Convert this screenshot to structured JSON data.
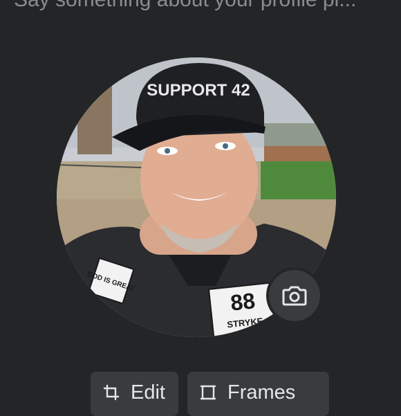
{
  "caption": {
    "placeholder": "Say something about your profile pi..."
  },
  "profile_photo": {
    "alt": "Profile picture preview",
    "cap_text": "SUPPORT 42",
    "patch_left": "GOD IS GREAT",
    "patch_right_number": "88",
    "patch_right_text": "STRYKE"
  },
  "actions": {
    "camera_icon": "camera-icon",
    "edit_label": "Edit",
    "edit_icon": "crop-icon",
    "frames_label": "Frames",
    "frames_icon": "frame-icon"
  },
  "colors": {
    "background": "#242526",
    "button_bg": "#3a3b3c",
    "button_text": "#e4e6eb",
    "placeholder_text": "#8a8d91"
  }
}
